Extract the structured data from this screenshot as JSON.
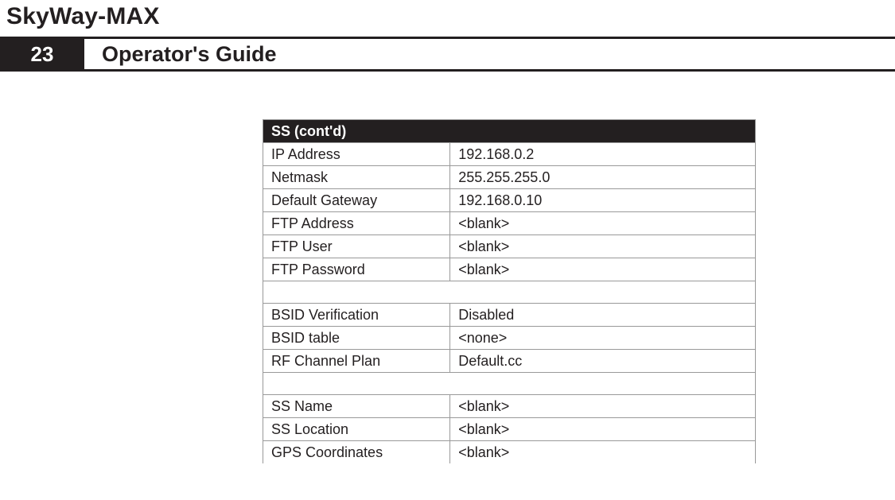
{
  "header": {
    "product": "SkyWay-MAX",
    "page_number": "23",
    "guide_title": "Operator's Guide"
  },
  "table": {
    "title": "SS (cont'd)",
    "groups": [
      [
        {
          "label": "IP Address",
          "value": "192.168.0.2"
        },
        {
          "label": "Netmask",
          "value": "255.255.255.0"
        },
        {
          "label": "Default Gateway",
          "value": "192.168.0.10"
        },
        {
          "label": "FTP Address",
          "value": "<blank>"
        },
        {
          "label": "FTP User",
          "value": "<blank>"
        },
        {
          "label": "FTP Password",
          "value": "<blank>"
        }
      ],
      [
        {
          "label": "BSID Verification",
          "value": "Disabled"
        },
        {
          "label": "BSID table",
          "value": "<none>"
        },
        {
          "label": "RF Channel Plan",
          "value": "Default.cc"
        }
      ],
      [
        {
          "label": "SS Name",
          "value": "<blank>"
        },
        {
          "label": "SS Location",
          "value": "<blank>"
        },
        {
          "label": "GPS Coordinates",
          "value": "<blank>"
        }
      ]
    ]
  }
}
